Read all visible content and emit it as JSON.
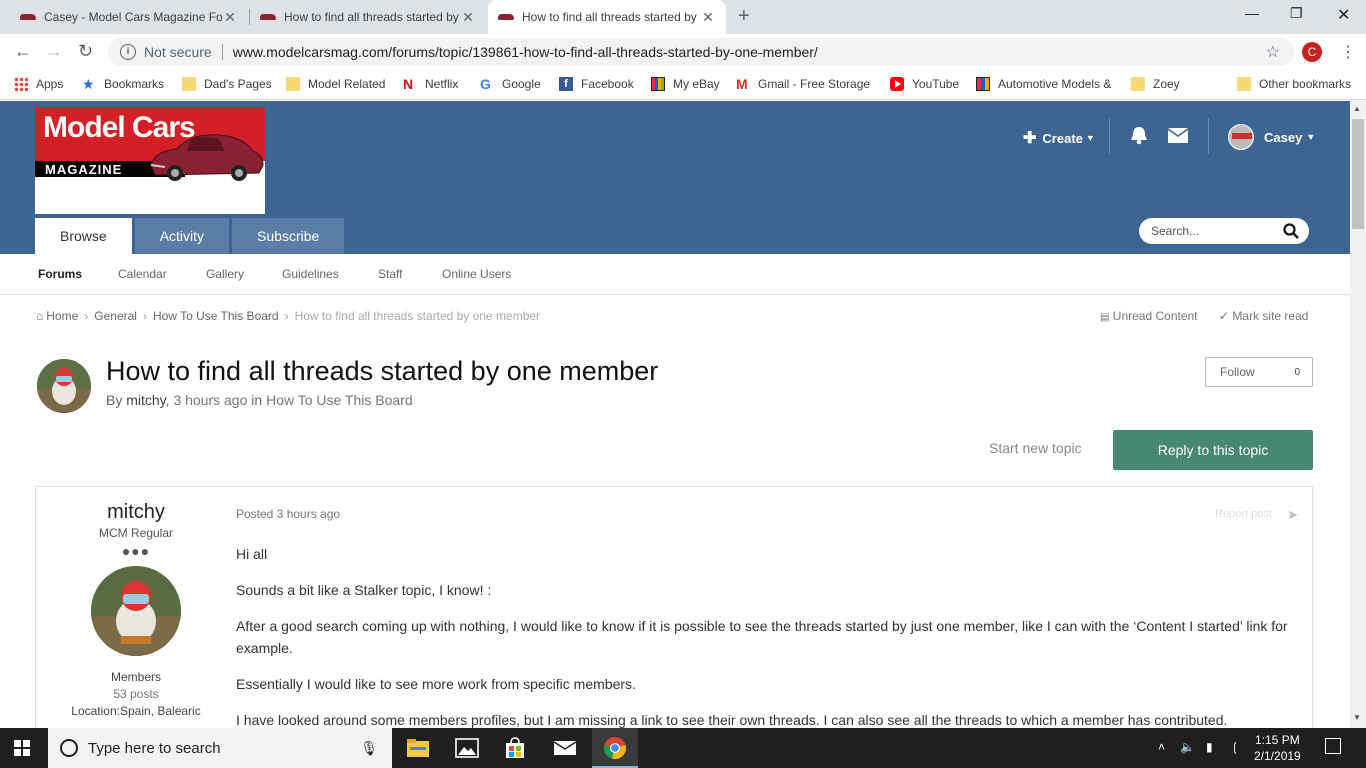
{
  "browser": {
    "tabs": [
      {
        "title": "Casey - Model Cars Magazine Fo"
      },
      {
        "title": "How to find all threads started by"
      },
      {
        "title": "How to find all threads started by"
      }
    ],
    "new_tab": "+",
    "close": "✕",
    "not_secure": "Not secure",
    "url": "www.modelcarsmag.com/forums/topic/139861-how-to-find-all-threads-started-by-one-member/",
    "profile_initial": "C",
    "bookmarks": [
      {
        "label": "Apps",
        "icon": "apps-icon"
      },
      {
        "label": "Bookmarks",
        "icon": "star-icon"
      },
      {
        "label": "Dad's Pages",
        "icon": "folder-icon"
      },
      {
        "label": "Model Related",
        "icon": "folder-icon"
      },
      {
        "label": "Netflix",
        "icon": "netflix-icon"
      },
      {
        "label": "Google",
        "icon": "google-icon"
      },
      {
        "label": "Facebook",
        "icon": "facebook-icon"
      },
      {
        "label": "My eBay",
        "icon": "ebay-icon"
      },
      {
        "label": "Gmail - Free Storage",
        "icon": "gmail-icon"
      },
      {
        "label": "YouTube",
        "icon": "youtube-icon"
      },
      {
        "label": "Automotive Models &",
        "icon": "automotive-icon"
      },
      {
        "label": "Zoey",
        "icon": "folder-icon"
      },
      {
        "label": "Other bookmarks",
        "icon": "folder-icon"
      }
    ]
  },
  "site": {
    "logo_line1": "Model Cars",
    "logo_line2": "MAGAZINE",
    "header": {
      "create": "Create",
      "user": "Casey"
    },
    "nav_tabs": [
      "Browse",
      "Activity",
      "Subscribe"
    ],
    "search_placeholder": "Search...",
    "subnav": [
      "Forums",
      "Calendar",
      "Gallery",
      "Guidelines",
      "Staff",
      "Online Users"
    ],
    "breadcrumbs": [
      "Home",
      "General",
      "How To Use This Board",
      "How to find all threads started by one member"
    ],
    "unread_content": "Unread Content",
    "mark_site_read": "Mark site read"
  },
  "topic": {
    "title": "How to find all threads started by one member",
    "by": "By",
    "author": "mitchy",
    "time": "3 hours ago",
    "in": "in",
    "forum": "How To Use This Board",
    "follow": "Follow",
    "follow_count": "0",
    "start_new_topic": "Start new topic",
    "reply": "Reply to this topic"
  },
  "post": {
    "author_name": "mitchy",
    "rank": "MCM Regular",
    "pips": "●●●",
    "group": "Members",
    "posts": "53 posts",
    "location": "Location:Spain, Balearic",
    "posted": "Posted 3 hours ago",
    "report": "Report post",
    "paragraphs": [
      "Hi all",
      "Sounds a bit like a Stalker topic, I know! :",
      "After a good search coming up with nothing, I would like to know if it is possible to see the threads started by just one member, like I can with the ‘Content I started’ link for example.",
      "Essentially I would like to see more work from specific members.",
      "I have looked around some members profiles, but I am missing a link to see their own threads. I can also see all the threads to which a member has contributed."
    ]
  },
  "taskbar": {
    "search_placeholder": "Type here to search",
    "time": "1:15 PM",
    "date": "2/1/2019"
  },
  "colors": {
    "header_blue": "#3d6594",
    "reply_green": "#468872",
    "logo_red": "#d41f26"
  }
}
